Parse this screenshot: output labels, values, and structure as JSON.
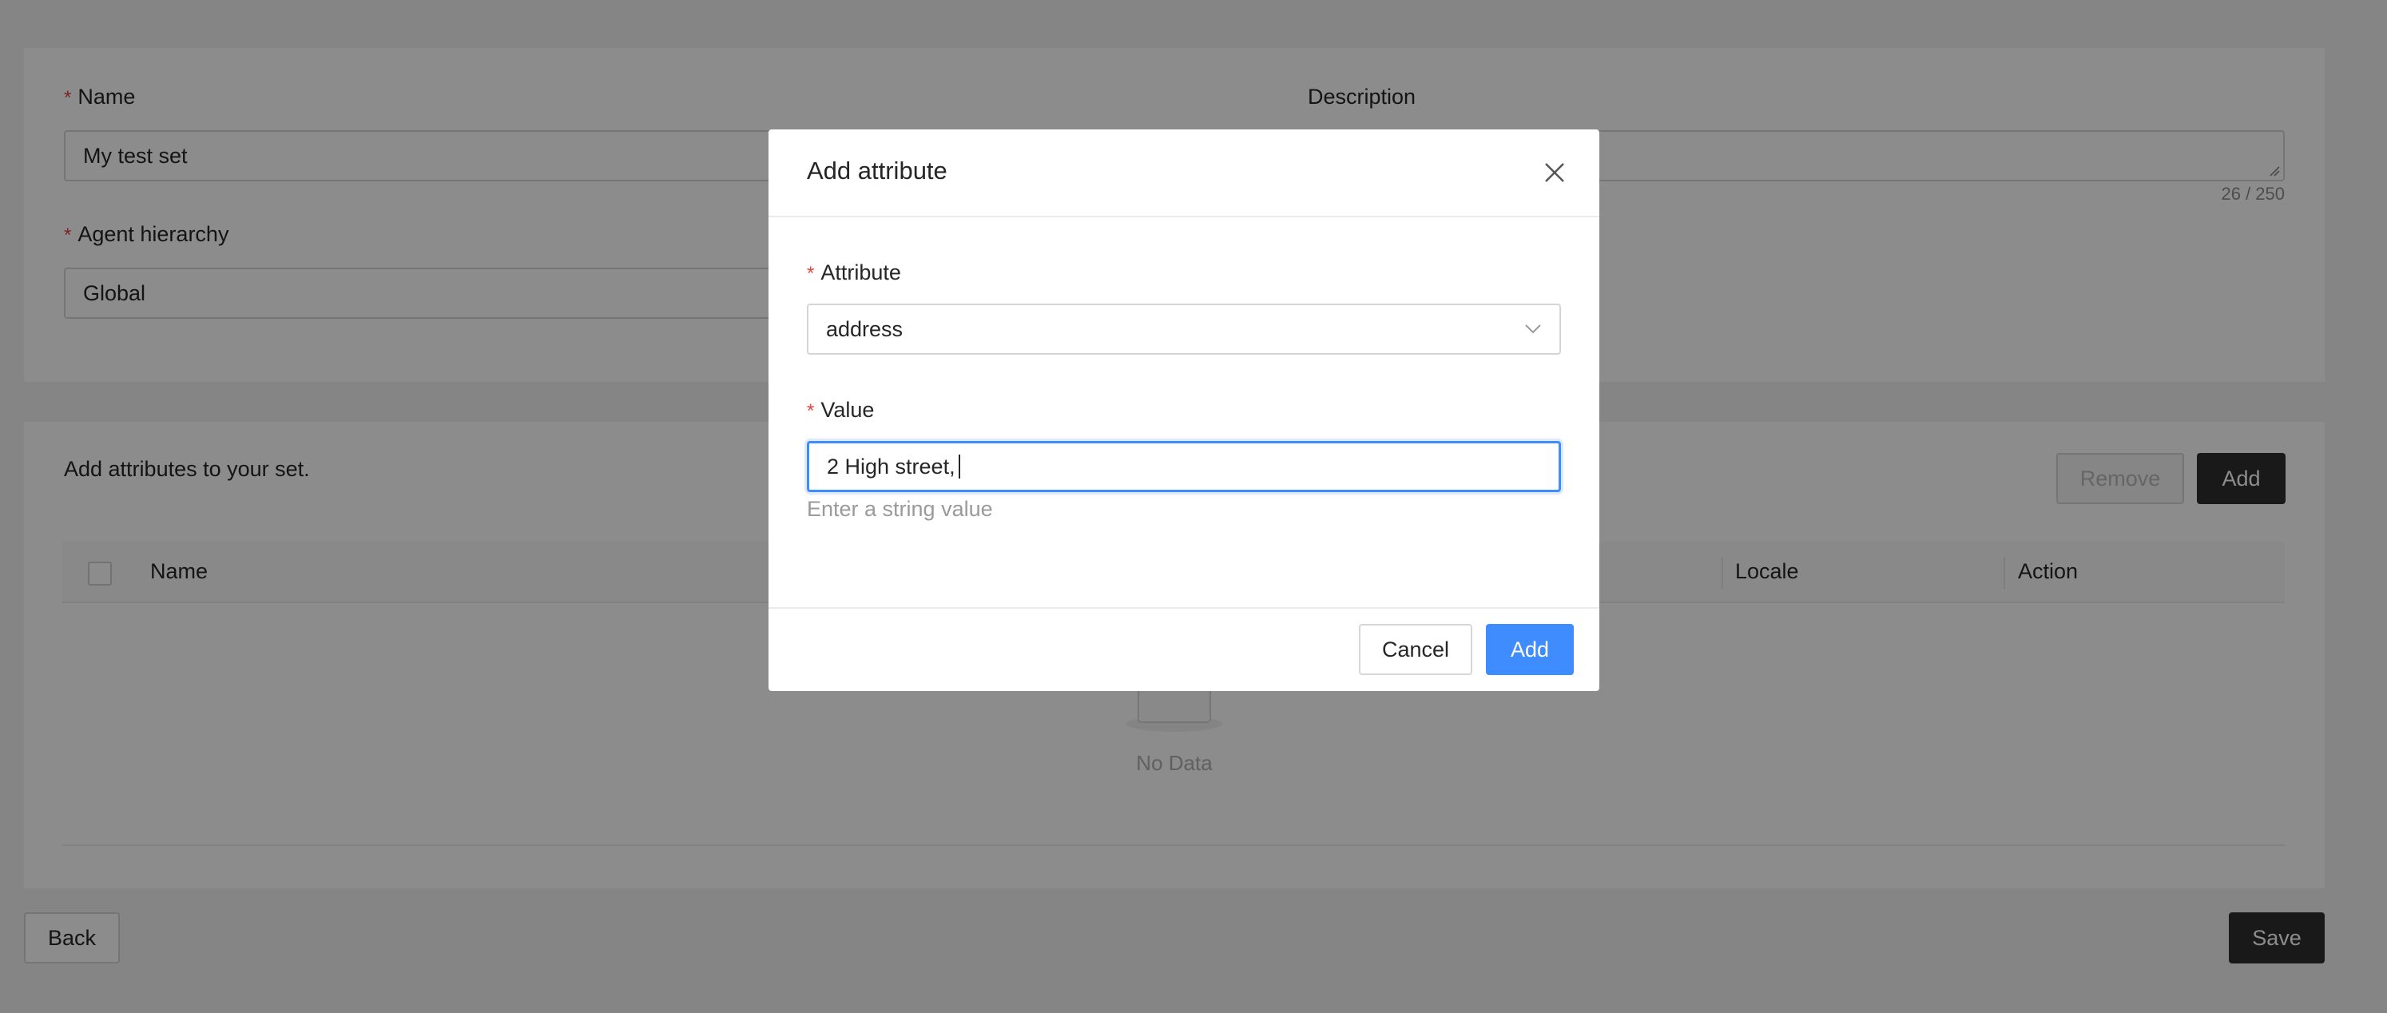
{
  "form": {
    "name_label": "Name",
    "name_value": "My test set",
    "description_label": "Description",
    "description_counter": "26 / 250",
    "agent_hierarchy_label": "Agent hierarchy",
    "agent_hierarchy_value": "Global"
  },
  "attributes_section": {
    "intro_text": "Add attributes to your set.",
    "remove_label": "Remove",
    "add_label": "Add",
    "columns": [
      "Name",
      "Locale",
      "Action"
    ],
    "empty_text": "No Data"
  },
  "footer": {
    "back_label": "Back",
    "save_label": "Save"
  },
  "modal": {
    "title": "Add attribute",
    "attribute_label": "Attribute",
    "attribute_value": "address",
    "value_label": "Value",
    "value_input": "2 High street,",
    "value_hint": "Enter a string value",
    "cancel_label": "Cancel",
    "add_label": "Add"
  },
  "colors": {
    "primary": "#3f8cff",
    "required_mark": "#e0453d",
    "dark_button": "#2f2f2f"
  },
  "icons": {
    "close": "close-icon",
    "dropdown": "chevron-down-icon",
    "empty": "empty-box-icon"
  }
}
